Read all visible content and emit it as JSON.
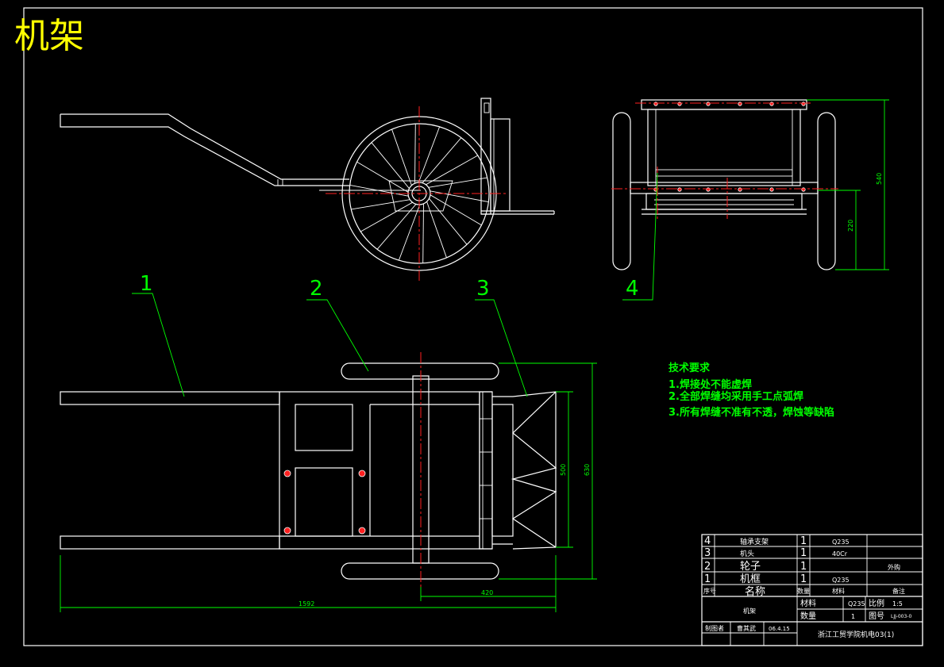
{
  "title": "机架",
  "callouts": [
    "1",
    "2",
    "3",
    "4"
  ],
  "dimensions": {
    "total_length": "1592",
    "front_length": "420",
    "inner_width": "500",
    "outer_width": "630",
    "side_height": "540",
    "axle_height": "220"
  },
  "tech_notes": {
    "heading": "技术要求",
    "items": [
      "1.焊接处不能虚焊",
      "2.全部焊缝均采用手工点弧焊",
      "3.所有焊缝不准有不透，焊蚀等缺陷"
    ]
  },
  "title_block": {
    "bom": [
      {
        "no": "4",
        "name": "轴承支架",
        "qty": "1",
        "material": "Q235",
        "note": ""
      },
      {
        "no": "3",
        "name": "机头",
        "qty": "1",
        "material": "40Cr",
        "note": ""
      },
      {
        "no": "2",
        "name": "轮子",
        "qty": "1",
        "material": "",
        "note": "外购"
      },
      {
        "no": "1",
        "name": "机框",
        "qty": "1",
        "material": "Q235",
        "note": ""
      }
    ],
    "header": {
      "no": "序号",
      "name": "名称",
      "qty": "数量",
      "material": "材料",
      "note": "备注"
    },
    "part_name": "机架",
    "material_label": "材料",
    "material_value": "Q235",
    "scale_label": "比例",
    "scale_value": "1:5",
    "qty_label": "数量",
    "qty_value": "1",
    "drawing_no_label": "图号",
    "drawing_no_value": "LJJ-003-0",
    "drawn_label": "制图者",
    "drawn_name": "曹其武",
    "date": "06.4.15",
    "school": "浙江工贸学院机电03(1)"
  }
}
